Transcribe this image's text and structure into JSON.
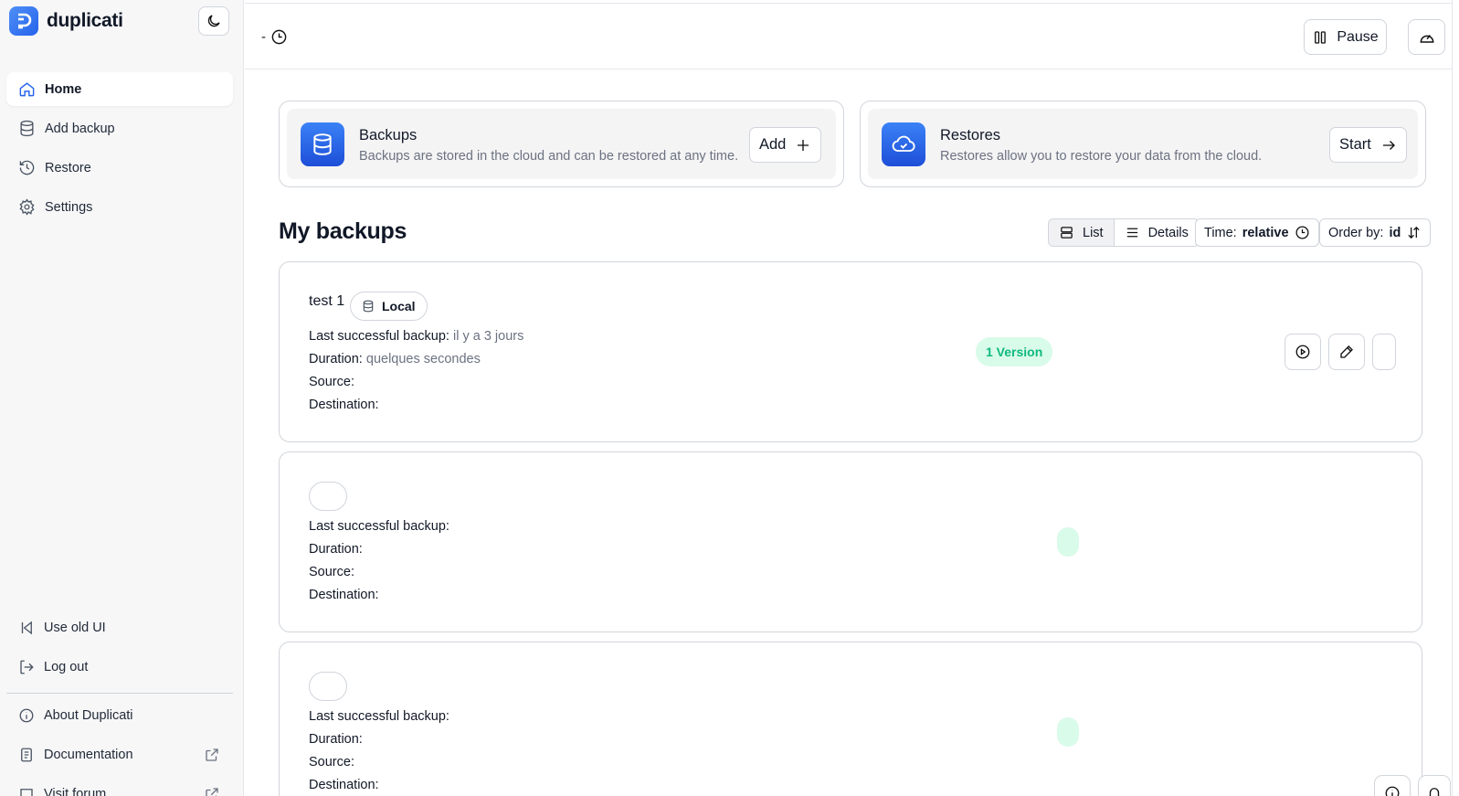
{
  "sidebar": {
    "brand": "duplicati",
    "items": [
      {
        "label": "Home",
        "icon": "home-icon"
      },
      {
        "label": "Add backup",
        "icon": "database-icon"
      },
      {
        "label": "Restore",
        "icon": "history-icon"
      },
      {
        "label": "Settings",
        "icon": "gear-icon"
      }
    ],
    "bottom_items": [
      {
        "label": "Use old UI",
        "icon": "back-to-start-icon"
      },
      {
        "label": "Log out",
        "icon": "logout-icon"
      },
      {
        "label": "About Duplicati",
        "icon": "info-icon"
      },
      {
        "label": "Documentation",
        "icon": "document-icon"
      },
      {
        "label": "Visit forum",
        "icon": "chat-icon"
      }
    ]
  },
  "topbar": {
    "status": "-",
    "pause_label": "Pause"
  },
  "cards": {
    "backups": {
      "title": "Backups",
      "description": "Backups are stored in the cloud and can be restored at any time.",
      "button": "Add"
    },
    "restores": {
      "title": "Restores",
      "description": "Restores allow you to restore your data from the cloud.",
      "button": "Start"
    }
  },
  "backups_section": {
    "title": "My backups",
    "view_list": "List",
    "view_details": "Details",
    "time_prefix": "Time:",
    "time_value": "relative",
    "order_prefix": "Order by:",
    "order_value": "id"
  },
  "labels": {
    "last_backup": "Last successful backup:",
    "duration": "Duration:",
    "source": "Source:",
    "destination": "Destination:"
  },
  "backups": [
    {
      "name": "test 1",
      "destination_type": "Local",
      "last_backup": "il y a 3 jours",
      "duration": "quelques secondes",
      "versions": "1 Version"
    }
  ],
  "colors": {
    "accent": "#2563eb",
    "version_bg": "#d9fbe9",
    "version_text": "#10b981"
  }
}
